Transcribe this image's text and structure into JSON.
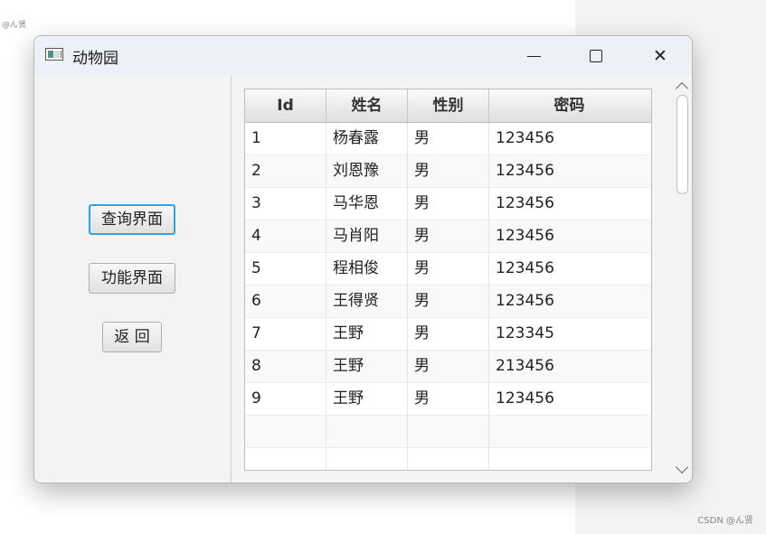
{
  "watermark_top": "@ん贤",
  "watermark_bottom": "CSDN @ん贤",
  "window": {
    "title": "动物园",
    "icon": "app-window-icon",
    "controls": {
      "minimize": "minimize-icon",
      "maximize": "maximize-icon",
      "close": "close-icon",
      "close_glyph": "✕"
    }
  },
  "left_panel": {
    "buttons": [
      {
        "label": "查询界面",
        "focused": true
      },
      {
        "label": "功能界面"
      },
      {
        "label": "返 回"
      }
    ]
  },
  "table": {
    "columns": [
      "Id",
      "姓名",
      "性别",
      "密码"
    ],
    "rows": [
      [
        "1",
        "杨春露",
        "男",
        "123456"
      ],
      [
        "2",
        "刘恩豫",
        "男",
        "123456"
      ],
      [
        "3",
        "马华恩",
        "男",
        "123456"
      ],
      [
        "4",
        "马肖阳",
        "男",
        "123456"
      ],
      [
        "5",
        "程相俊",
        "男",
        "123456"
      ],
      [
        "6",
        "王得贤",
        "男",
        "123456"
      ],
      [
        "7",
        "王野",
        "男",
        "123345"
      ],
      [
        "8",
        "王野",
        "男",
        "213456"
      ],
      [
        "9",
        "王野",
        "男",
        "123456"
      ]
    ],
    "empty_rows": 2
  },
  "colors": {
    "focus_border": "#2da4e6"
  }
}
